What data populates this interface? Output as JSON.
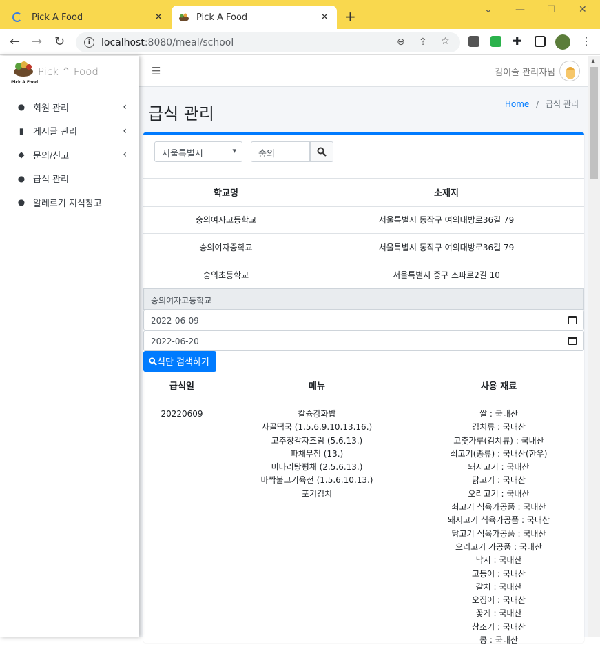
{
  "browser": {
    "tabs": [
      {
        "title": "Pick A Food"
      },
      {
        "title": "Pick A Food"
      }
    ],
    "url_host": "localhost",
    "url_path": ":8080/meal/school"
  },
  "sidebar": {
    "brand": "Pick ^ Food",
    "logo_text": "Pick A Food",
    "items": [
      {
        "label": "회원 관리"
      },
      {
        "label": "게시글 관리"
      },
      {
        "label": "문의/신고"
      },
      {
        "label": "급식 관리"
      },
      {
        "label": "알레르기 지식창고"
      }
    ]
  },
  "header": {
    "user": "김이슬 관리자님"
  },
  "content": {
    "title": "급식 관리",
    "breadcrumb": {
      "home": "Home",
      "sep": "/",
      "current": "급식 관리"
    }
  },
  "filter": {
    "region": "서울특별시",
    "query": "숭의"
  },
  "schools": {
    "headers": [
      "학교명",
      "소재지"
    ],
    "rows": [
      [
        "숭의여자고등학교",
        "서울특별시 동작구 여의대방로36길 79"
      ],
      [
        "숭의여자중학교",
        "서울특별시 동작구 여의대방로36길 79"
      ],
      [
        "숭의초등학교",
        "서울특별시 중구 소파로2길 10"
      ]
    ]
  },
  "selected_school": "숭의여자고등학교",
  "date_from": "2022-06-09",
  "date_to": "2022-06-20",
  "search_button": "식단 검색하기",
  "meals": {
    "headers": [
      "급식일",
      "메뉴",
      "사용 재료"
    ],
    "date": "20220609",
    "menu": [
      "칼슘강화밥",
      "사골떡국 (1.5.6.9.10.13.16.)",
      "고추장감자조림 (5.6.13.)",
      "파채무침 (13.)",
      "미나리탕평채 (2.5.6.13.)",
      "바싹불고기육전 (1.5.6.10.13.)",
      "포기김치"
    ],
    "ingredients": [
      "쌀 : 국내산",
      "김치류 : 국내산",
      "고춧가루(김치류) : 국내산",
      "쇠고기(종류) : 국내산(한우)",
      "돼지고기 : 국내산",
      "닭고기 : 국내산",
      "오리고기 : 국내산",
      "쇠고기 식육가공품 : 국내산",
      "돼지고기 식육가공품 : 국내산",
      "닭고기 식육가공품 : 국내산",
      "오리고기 가공품 : 국내산",
      "낙지 : 국내산",
      "고등어 : 국내산",
      "갈치 : 국내산",
      "오징어 : 국내산",
      "꽃게 : 국내산",
      "참조기 : 국내산",
      "콩 : 국내산"
    ]
  }
}
